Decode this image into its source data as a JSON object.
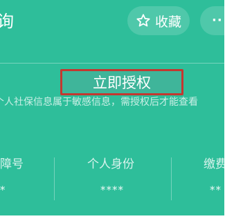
{
  "header": {
    "title": "询",
    "favorite_label": "收藏",
    "more_label": "··"
  },
  "auth": {
    "button_label": "立即授权",
    "notice": "个人社保信息属于敏感信息，需授权后才能查看"
  },
  "info_columns": [
    {
      "label": "障号",
      "value": "*"
    },
    {
      "label": "个人身份",
      "value": "****"
    },
    {
      "label": "缴费",
      "value": "**"
    }
  ],
  "colors": {
    "background": "#2ebe9a",
    "highlight_border": "#c5372f",
    "text": "#ffffff"
  },
  "icons": {
    "favorite": "star-outline-icon",
    "more": "more-dots-icon"
  }
}
